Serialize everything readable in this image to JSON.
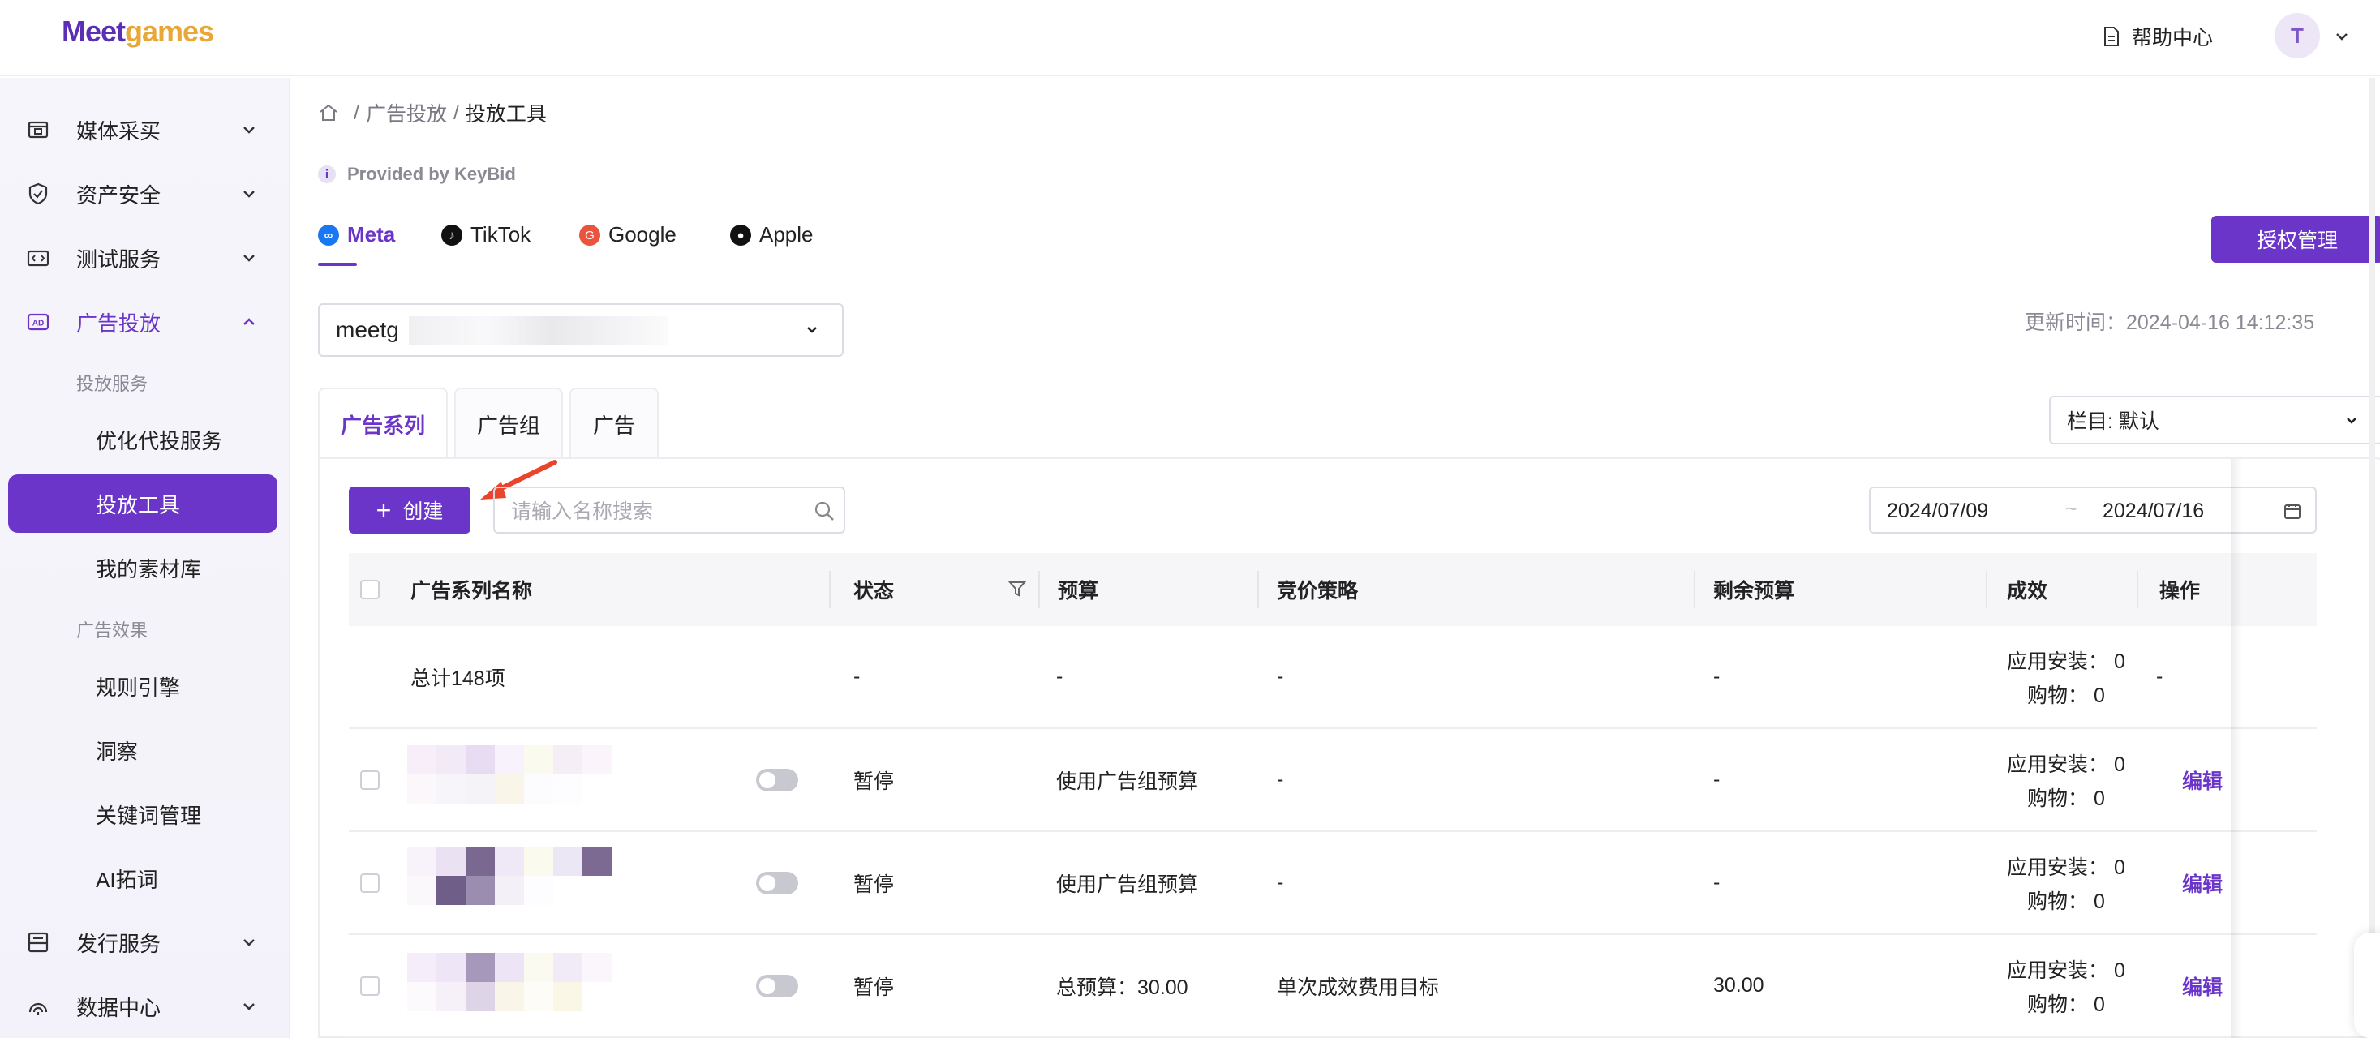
{
  "header": {
    "logo_meet": "Meet",
    "logo_games": "games",
    "help_label": "帮助中心",
    "avatar_initial": "T"
  },
  "sidebar": {
    "groups": [
      {
        "label": "媒体采买",
        "icon": "media-buy-icon"
      },
      {
        "label": "资产安全",
        "icon": "shield-icon"
      },
      {
        "label": "测试服务",
        "icon": "test-service-icon"
      },
      {
        "label": "广告投放",
        "icon": "ad-icon"
      },
      {
        "label": "发行服务",
        "icon": "publish-icon"
      },
      {
        "label": "数据中心",
        "icon": "data-center-icon"
      }
    ],
    "sections": [
      "投放服务",
      "广告效果"
    ],
    "items": [
      "优化代投服务",
      "投放工具",
      "我的素材库",
      "规则引擎",
      "洞察",
      "关键词管理",
      "AI拓词"
    ]
  },
  "breadcrumb": {
    "items": [
      "广告投放",
      "投放工具"
    ],
    "separator": "/"
  },
  "provided_by": "Provided by KeyBid",
  "platform_tabs": [
    {
      "label": "Meta",
      "active": true,
      "color": "#1877f2"
    },
    {
      "label": "TikTok",
      "active": false,
      "color": "#111111"
    },
    {
      "label": "Google",
      "active": false,
      "color": "#e8543e"
    },
    {
      "label": "Apple",
      "active": false,
      "color": "#111111"
    }
  ],
  "auth_button": "授权管理",
  "account_select": {
    "value": "meetg"
  },
  "update_time": "更新时间：2024-04-16 14:12:35",
  "level_tabs": [
    "广告系列",
    "广告组",
    "广告"
  ],
  "columns_select": "栏目: 默认",
  "toolbar": {
    "create_label": "创建",
    "search_placeholder": "请输入名称搜索",
    "date_start": "2024/07/09",
    "date_sep": "~",
    "date_end": "2024/07/16"
  },
  "table": {
    "headers": {
      "name": "广告系列名称",
      "status": "状态",
      "budget": "预算",
      "bid": "竞价策略",
      "remaining": "剩余预算",
      "result": "成效",
      "ops": "操作"
    },
    "summary": {
      "name": "总计148项",
      "status": "-",
      "budget": "-",
      "bid": "-",
      "remaining": "-",
      "result_install": "应用安装： 0",
      "result_purchase": "购物： 0",
      "ops": "-"
    },
    "rows": [
      {
        "status": "暂停",
        "budget": "使用广告组预算",
        "bid": "-",
        "remaining": "-",
        "result_install": "应用安装： 0",
        "result_purchase": "购物： 0",
        "op": "编辑"
      },
      {
        "status": "暂停",
        "budget": "使用广告组预算",
        "bid": "-",
        "remaining": "-",
        "result_install": "应用安装： 0",
        "result_purchase": "购物： 0",
        "op": "编辑"
      },
      {
        "status": "暂停",
        "budget": "总预算：30.00",
        "bid": "单次成效费用目标",
        "remaining": "30.00",
        "result_install": "应用安装： 0",
        "result_purchase": "购物： 0",
        "op": "编辑"
      }
    ]
  },
  "colors": {
    "accent": "#6a35c8",
    "logo_orange": "#e8a736"
  }
}
